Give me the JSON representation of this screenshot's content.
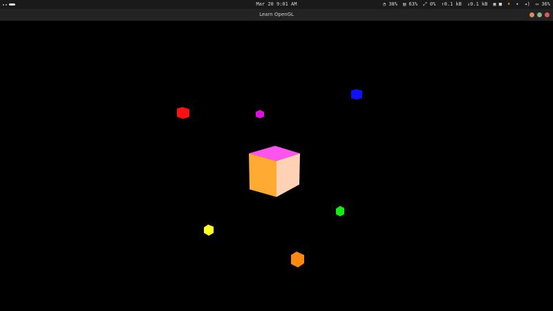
{
  "topbar": {
    "datetime": "Mar 20  9:01 AM",
    "cpu": "38%",
    "mem": "63%",
    "disk": "0%",
    "net_up": "0.1 kB",
    "net_down": "0.1 kB",
    "battery": "36%"
  },
  "window": {
    "title": "Learn OpenGL",
    "controls": [
      {
        "name": "minimize",
        "color": "#e08a55"
      },
      {
        "name": "maximize",
        "color": "#8ab48a"
      },
      {
        "name": "close",
        "color": "#e05555"
      }
    ]
  },
  "scene": {
    "center_cube": {
      "top": "#ff55ee",
      "left": "#ffaa33",
      "right": "#ffd1b5"
    },
    "light_cubes": [
      {
        "name": "red",
        "color": "#ff1111"
      },
      {
        "name": "magenta",
        "color": "#dd11dd"
      },
      {
        "name": "blue",
        "color": "#1111ff"
      },
      {
        "name": "green",
        "color": "#11ee11"
      },
      {
        "name": "yellow",
        "color": "#ffff22"
      },
      {
        "name": "orange",
        "color": "#ff8811"
      }
    ]
  }
}
